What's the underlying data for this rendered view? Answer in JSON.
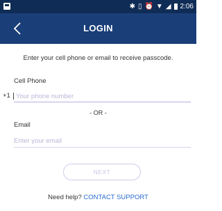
{
  "status_bar": {
    "time": "2:06",
    "icons": [
      "bluetooth-icon",
      "vibrate-icon",
      "alarm-icon",
      "wifi-icon",
      "signal-icon",
      "battery-icon"
    ],
    "background_color": "#0f2c56"
  },
  "app_bar": {
    "title": "LOGIN",
    "back_glyph": "back-chevron-icon",
    "background_color": "#1a3e78"
  },
  "form": {
    "instruction": "Enter your cell phone or email to receive passcode.",
    "phone": {
      "label": "Cell Phone",
      "country_code": "+1",
      "placeholder": "Your phone number",
      "value": ""
    },
    "separator": "- OR -",
    "email": {
      "label": "Email",
      "placeholder": "Enter your email",
      "value": ""
    },
    "next_label": "NEXT"
  },
  "help": {
    "prompt": "Need help?",
    "link_label": "CONTACT SUPPORT",
    "link_color": "#2a6bd1"
  }
}
